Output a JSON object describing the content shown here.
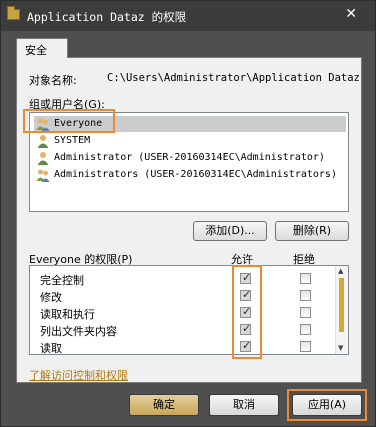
{
  "window": {
    "title": "Application Dataz 的权限",
    "close": "✕"
  },
  "tabs": [
    {
      "label": "安全"
    }
  ],
  "object": {
    "label": "对象名称:",
    "value": "C:\\Users\\Administrator\\Application Dataz"
  },
  "groups": {
    "label": "组或用户名(G):",
    "items": [
      {
        "name": "Everyone",
        "icon": "users-group-icon",
        "selected": true
      },
      {
        "name": "SYSTEM",
        "icon": "user-icon"
      },
      {
        "name": "Administrator (USER-20160314EC\\Administrator)",
        "icon": "user-icon"
      },
      {
        "name": "Administrators (USER-20160314EC\\Administrators)",
        "icon": "users-group-icon"
      }
    ]
  },
  "buttons": {
    "add": "添加(D)...",
    "remove": "删除(R)",
    "ok": "确定",
    "cancel": "取消",
    "apply": "应用(A)"
  },
  "permissions": {
    "label": "Everyone 的权限(P)",
    "allow_header": "允许",
    "deny_header": "拒绝",
    "rows": [
      {
        "name": "完全控制",
        "allow": true,
        "deny": false
      },
      {
        "name": "修改",
        "allow": true,
        "deny": false
      },
      {
        "name": "读取和执行",
        "allow": true,
        "deny": false
      },
      {
        "name": "列出文件夹内容",
        "allow": true,
        "deny": false
      },
      {
        "name": "读取",
        "allow": true,
        "deny": false
      }
    ]
  },
  "link": "了解访问控制和权限",
  "colors": {
    "highlight": "#f0892e",
    "accent": "#d4a93c",
    "window_bg": "#4f4f4f"
  }
}
